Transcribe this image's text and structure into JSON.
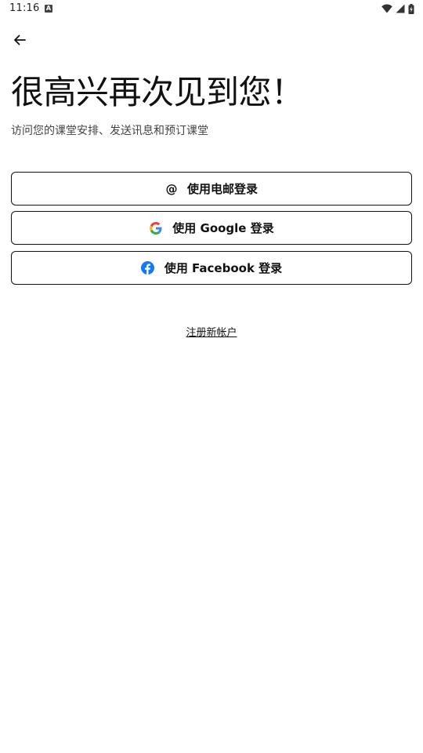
{
  "status_bar": {
    "time": "11:16",
    "keyboard_indicator": "A"
  },
  "header": {
    "back_icon": "arrow-left-icon"
  },
  "main": {
    "title": "很高兴再次见到您！",
    "subtitle": "访问您的课堂安排、发送讯息和预订课堂",
    "buttons": {
      "email": {
        "label": "使用电邮登录",
        "icon": "at-icon",
        "symbol": "@"
      },
      "google": {
        "label": "使用 Google 登录",
        "icon": "google-icon"
      },
      "facebook": {
        "label": "使用 Facebook 登录",
        "icon": "facebook-icon"
      }
    },
    "register_link": "注册新帐户"
  },
  "colors": {
    "google_blue": "#4285F4",
    "google_red": "#EA4335",
    "google_yellow": "#FBBC05",
    "google_green": "#34A853",
    "facebook_blue": "#1877F2",
    "border": "#111111"
  }
}
